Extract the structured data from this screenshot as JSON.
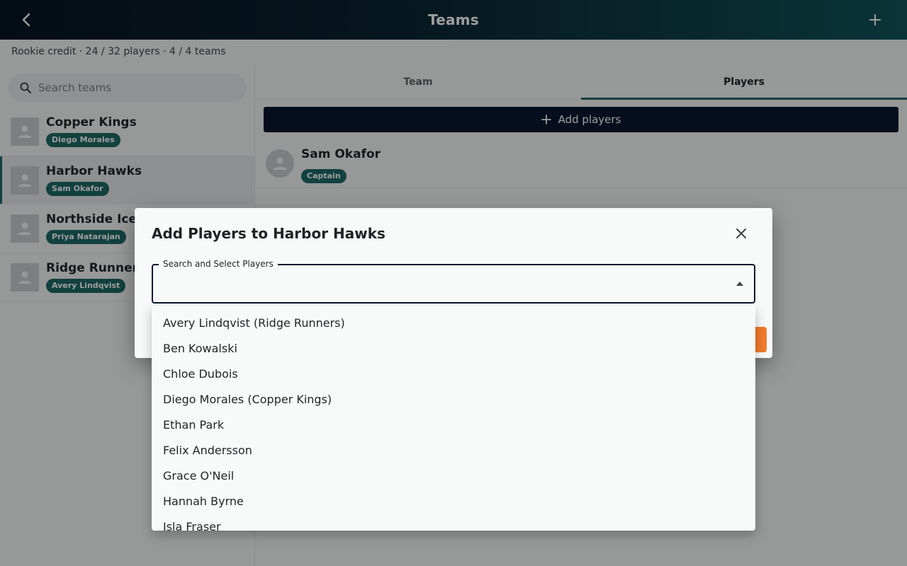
{
  "app": {
    "title": "Teams",
    "back_icon": "chevron-left-icon",
    "add_icon": "plus-icon"
  },
  "subheader": {
    "text": "Rookie credit · 24 / 32 players · 4 / 4 teams"
  },
  "sidebar": {
    "search": {
      "placeholder": "Search teams",
      "value": ""
    },
    "teams": [
      {
        "name": "Copper Kings",
        "captain": "Diego Morales",
        "selected": false
      },
      {
        "name": "Harbor Hawks",
        "captain": "Sam Okafor",
        "selected": true
      },
      {
        "name": "Northside Ice",
        "captain": "Priya Natarajan",
        "selected": false
      },
      {
        "name": "Ridge Runners",
        "captain": "Avery Lindqvist",
        "selected": false
      }
    ]
  },
  "main": {
    "tabs": [
      {
        "label": "Team",
        "active": false
      },
      {
        "label": "Players",
        "active": true
      }
    ],
    "add_players_label": "Add players",
    "players": [
      {
        "name": "Sam Okafor",
        "role": "Captain"
      }
    ]
  },
  "dialog": {
    "title": "Add Players to Harbor Hawks",
    "field_label": "Search and Select Players",
    "field_value": "",
    "options": [
      "Avery Lindqvist (Ridge Runners)",
      "Ben Kowalski",
      "Chloe Dubois",
      "Diego Morales (Copper Kings)",
      "Ethan Park",
      "Felix Andersson",
      "Grace O'Neil",
      "Hannah Byrne",
      "Isla Fraser"
    ]
  },
  "colors": {
    "accent": "#1e6a66",
    "primary_button": "#0b1730",
    "confirm_button": "#f07a2d"
  }
}
